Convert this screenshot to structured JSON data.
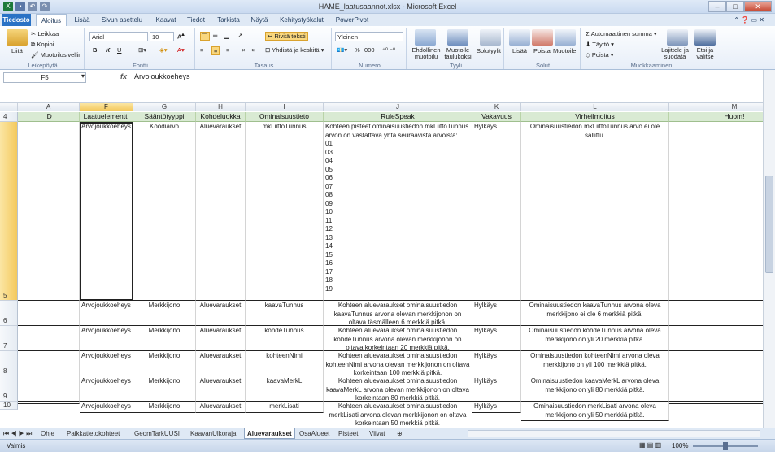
{
  "window": {
    "title": "HAME_laatusaannot.xlsx - Microsoft Excel"
  },
  "ribbon_tabs": [
    "Tiedosto",
    "Aloitus",
    "Lisää",
    "Sivun asettelu",
    "Kaavat",
    "Tiedot",
    "Tarkista",
    "Näytä",
    "Kehitystyökalut",
    "PowerPivot"
  ],
  "ribbon": {
    "clipboard": {
      "paste": "Liitä",
      "cut": "Leikkaa",
      "copy": "Kopioi",
      "format_painter": "Muotoilusivellin",
      "label": "Leikepöytä"
    },
    "font": {
      "name": "Arial",
      "size": "10",
      "bold": "B",
      "italic": "K",
      "underline": "U",
      "label": "Fontti"
    },
    "alignment": {
      "wrap": "Rivitä teksti",
      "merge": "Yhdistä ja keskitä",
      "label": "Tasaus"
    },
    "number": {
      "format": "Yleinen",
      "percent": "%",
      "thousands": "000",
      "label": "Numero"
    },
    "styles": {
      "conditional": "Ehdollinen muotoilu",
      "table": "Muotoile taulukoksi",
      "cell_styles": "Solutyylit",
      "label": "Tyyli"
    },
    "cells": {
      "insert": "Lisää",
      "delete": "Poista",
      "format": "Muotoile",
      "label": "Solut"
    },
    "editing": {
      "autosum": "Automaattinen summa",
      "fill": "Täyttö",
      "clear": "Poista",
      "sort": "Lajittele ja suodata",
      "find": "Etsi ja valitse",
      "label": "Muokkaaminen"
    }
  },
  "formula_bar": {
    "name_box": "F5",
    "fx": "fx",
    "content": "Arvojoukkoeheys"
  },
  "columns": [
    "A",
    "F",
    "G",
    "H",
    "I",
    "J",
    "K",
    "L",
    "M"
  ],
  "header_row": {
    "num": "4",
    "cells": [
      "ID",
      "Laatuelementti",
      "Sääntötyyppi",
      "Kohdeluokka",
      "Ominaisuustieto",
      "RuleSpeak",
      "Vakavuus",
      "Virheilmoitus",
      "Huom!"
    ]
  },
  "rows": [
    {
      "num": "5",
      "cells": [
        "",
        "Arvojoukkoeheys",
        "Koodiarvo",
        "Aluevaraukset",
        "mkLiittoTunnus",
        "Kohteen pisteet ominaisuustiedon mkLiittoTunnus arvon on vastattava yhtä seuraavista arvoista:\n01\n03\n04\n05\n06\n07\n08\n09\n10\n11\n12\n13\n14\n15\n16\n17\n18\n19",
        "Hylkäys",
        "Ominaisuustiedon mkLiittoTunnus arvo ei ole sallittu.",
        ""
      ]
    },
    {
      "num": "6",
      "cells": [
        "",
        "Arvojoukkoeheys",
        "Merkkijono",
        "Aluevaraukset",
        "kaavaTunnus",
        "Kohteen aluevaraukset ominaisuustiedon kaavaTunnus arvona olevan merkkijonon on oltava täsmälleen 6 merkkiä pitkä.",
        "Hylkäys",
        "Ominaisuustiedon kaavaTunnus arvona oleva merkkijono ei ole 6 merkkiä pitkä.",
        ""
      ]
    },
    {
      "num": "7",
      "cells": [
        "",
        "Arvojoukkoeheys",
        "Merkkijono",
        "Aluevaraukset",
        "kohdeTunnus",
        "Kohteen aluevaraukset ominaisuustiedon kohdeTunnus arvona olevan merkkijonon on oltava korkeintaan 20 merkkiä pitkä.",
        "Hylkäys",
        "Ominaisuustiedon kohdeTunnus arvona oleva merkkijono on yli 20 merkkiä pitkä.",
        ""
      ]
    },
    {
      "num": "8",
      "cells": [
        "",
        "Arvojoukkoeheys",
        "Merkkijono",
        "Aluevaraukset",
        "kohteenNimi",
        "Kohteen aluevaraukset ominaisuustiedon kohteenNimi arvona olevan merkkijonon on oltava korkeintaan 100 merkkiä pitkä.",
        "Hylkäys",
        "Ominaisuustiedon kohteenNimi arvona oleva merkkijono on yli 100 merkkiä pitkä.",
        ""
      ]
    },
    {
      "num": "9",
      "cells": [
        "",
        "Arvojoukkoeheys",
        "Merkkijono",
        "Aluevaraukset",
        "kaavaMerkL",
        "Kohteen aluevaraukset ominaisuustiedon kaavaMerkL arvona olevan merkkijonon on oltava korkeintaan 80 merkkiä pitkä.",
        "Hylkäys",
        "Ominaisuustiedon kaavaMerkL arvona oleva merkkijono on yli 80 merkkiä pitkä.",
        ""
      ]
    },
    {
      "num": "10",
      "cells": [
        "",
        "Arvojoukkoeheys",
        "Merkkijono",
        "Aluevaraukset",
        "merkLisati",
        "Kohteen aluevaraukset ominaisuustiedon merkLisati arvona olevan merkkijonon on oltava korkeintaan 50 merkkiä pitkä.",
        "Hylkäys",
        "Ominaisuustiedon merkLisati arvona oleva merkkijono on yli 50 merkkiä pitkä.",
        ""
      ]
    }
  ],
  "sheet_tabs": [
    "Ohje",
    "Paikkatietokohteet",
    "GeomTarkUUSI",
    "KaavanUlkoraja",
    "Aluevaraukset",
    "OsaAlueet",
    "Pisteet",
    "Viivat"
  ],
  "active_sheet": "Aluevaraukset",
  "status": {
    "mode": "Valmis",
    "zoom": "100%"
  },
  "colors": {
    "file_tab": "#2a72c5",
    "header_fill": "#d9ead3",
    "selection": "#f4c95d"
  }
}
